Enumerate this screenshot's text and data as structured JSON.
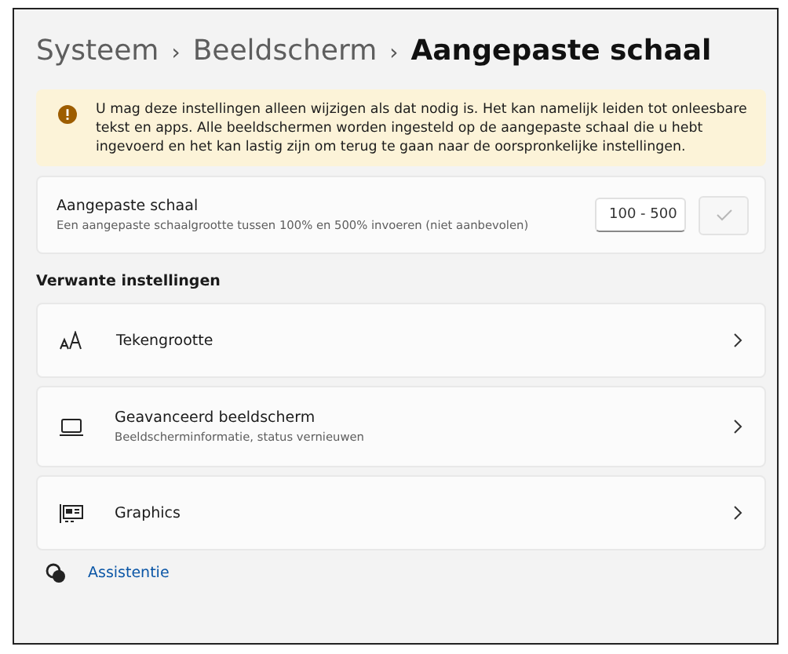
{
  "breadcrumb": [
    {
      "label": "Systeem",
      "current": false
    },
    {
      "label": "Beeldscherm",
      "current": false
    },
    {
      "label": "Aangepaste schaal",
      "current": true
    }
  ],
  "breadcrumb_separator": "›",
  "warning": "U mag deze instellingen alleen wijzigen als dat nodig is. Het kan namelijk leiden tot onleesbare tekst en apps. Alle beeldschermen worden ingesteld op de aangepaste schaal die u hebt ingevoerd en het kan lastig zijn om terug te gaan naar de oorspronkelijke instellingen.",
  "custom_scale": {
    "title": "Aangepaste schaal",
    "description": "Een aangepaste schaalgrootte tussen 100% en 500% invoeren (niet aanbevolen)",
    "placeholder": "100 - 500",
    "apply_disabled": true
  },
  "related_heading": "Verwante instellingen",
  "related": [
    {
      "kind": "text-size",
      "title": "Tekengrootte"
    },
    {
      "kind": "monitor",
      "title": "Geavanceerd beeldscherm",
      "subtitle": "Beeldscherminformatie, status vernieuwen"
    },
    {
      "kind": "graphics",
      "title": "Graphics"
    }
  ],
  "help_link": "Assistentie"
}
